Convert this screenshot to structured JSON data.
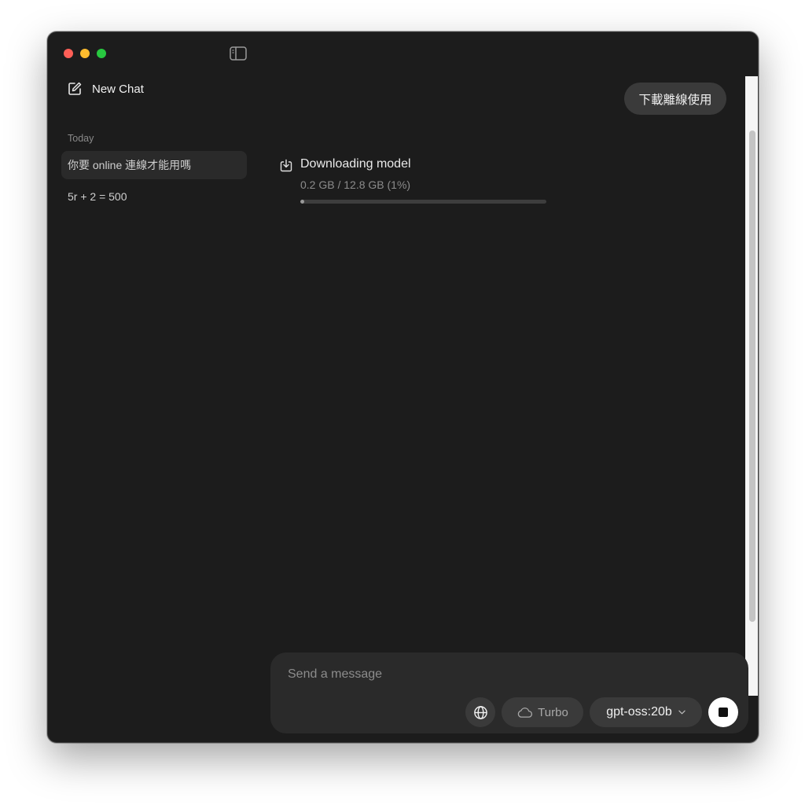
{
  "sidebar": {
    "new_chat_label": "New Chat",
    "section_label": "Today",
    "items": [
      {
        "label": "你要 online 連線才能用嗎",
        "active": true
      },
      {
        "label": "5r + 2 = 500",
        "active": false
      }
    ]
  },
  "header": {
    "offline_button_label": "下載離線使用"
  },
  "download": {
    "title": "Downloading model",
    "size_text": "0.2 GB / 12.8 GB (1%)",
    "progress_fraction": 0.01
  },
  "composer": {
    "placeholder": "Send a message",
    "turbo_label": "Turbo",
    "model_label": "gpt-oss:20b"
  },
  "colors": {
    "window_bg": "#1c1c1c",
    "close": "#ff5f57",
    "minimize": "#febc2e",
    "zoom": "#28c840"
  },
  "icons": [
    "sidebar-toggle-icon",
    "compose-icon",
    "download-icon",
    "globe-icon",
    "cloud-icon",
    "chevron-down-icon",
    "stop-icon"
  ]
}
